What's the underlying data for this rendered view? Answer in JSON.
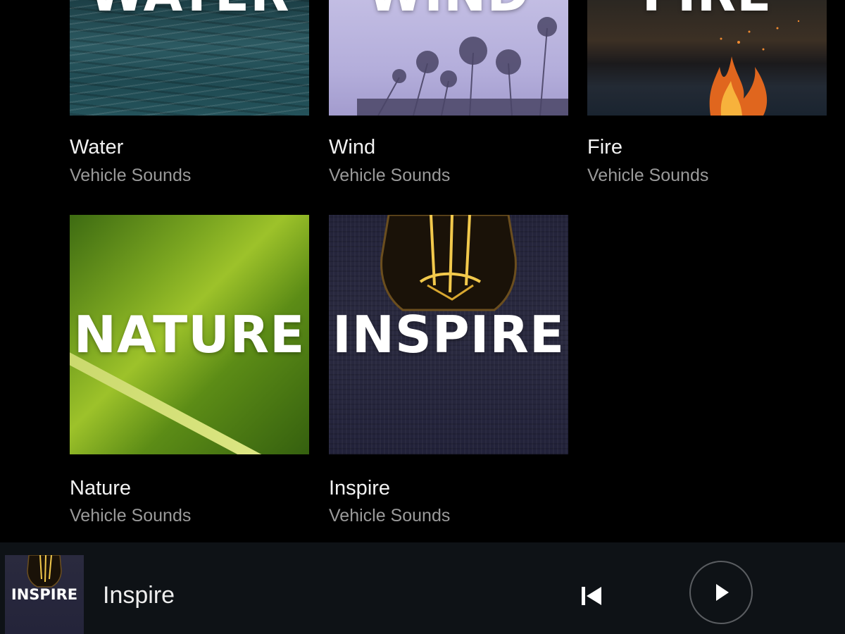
{
  "tiles": [
    {
      "art_word": "WATER",
      "title": "Water",
      "subtitle": "Vehicle Sounds"
    },
    {
      "art_word": "WIND",
      "title": "Wind",
      "subtitle": "Vehicle Sounds"
    },
    {
      "art_word": "FIRE",
      "title": "Fire",
      "subtitle": "Vehicle Sounds"
    },
    {
      "art_word": "NATURE",
      "title": "Nature",
      "subtitle": "Vehicle Sounds"
    },
    {
      "art_word": "INSPIRE",
      "title": "Inspire",
      "subtitle": "Vehicle Sounds"
    }
  ],
  "player": {
    "thumb_word": "INSPIRE",
    "title": "Inspire",
    "prev_icon": "skip-previous-icon",
    "play_icon": "play-icon"
  },
  "colors": {
    "background": "#000000",
    "player_bar": "#0e1216",
    "title_text": "#f2f2f2",
    "subtitle_text": "#9a9a9a"
  }
}
